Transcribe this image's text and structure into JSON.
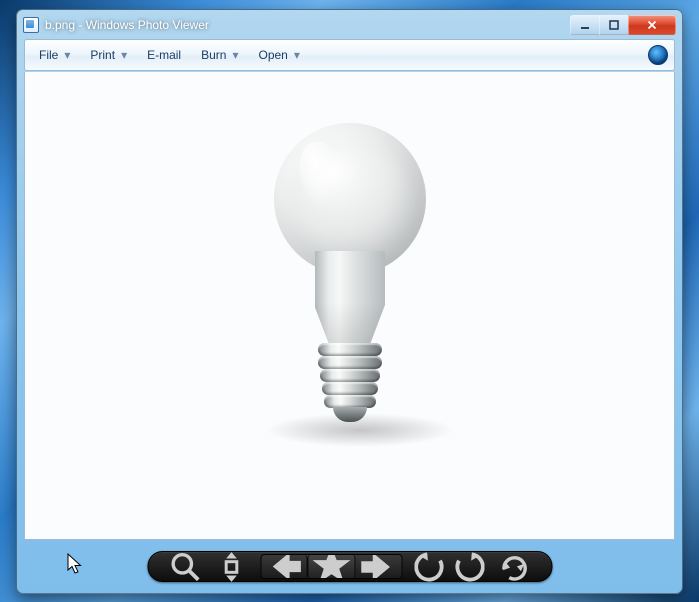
{
  "window": {
    "title": "b.png - Windows Photo Viewer",
    "app_icon": "photo-viewer-icon"
  },
  "menu": {
    "file": "File",
    "print": "Print",
    "email": "E-mail",
    "burn": "Burn",
    "open": "Open"
  },
  "toolbar": {
    "zoom_icon": "magnifier-icon",
    "fit_icon": "fit-to-screen-icon",
    "prev_icon": "previous-image-icon",
    "slideshow_icon": "slideshow-icon",
    "next_icon": "next-image-icon",
    "rotate_ccw_icon": "rotate-counterclockwise-icon",
    "rotate_cw_icon": "rotate-clockwise-icon",
    "delete_icon": "delete-icon"
  },
  "image": {
    "content": "lightbulb-off-icon"
  }
}
